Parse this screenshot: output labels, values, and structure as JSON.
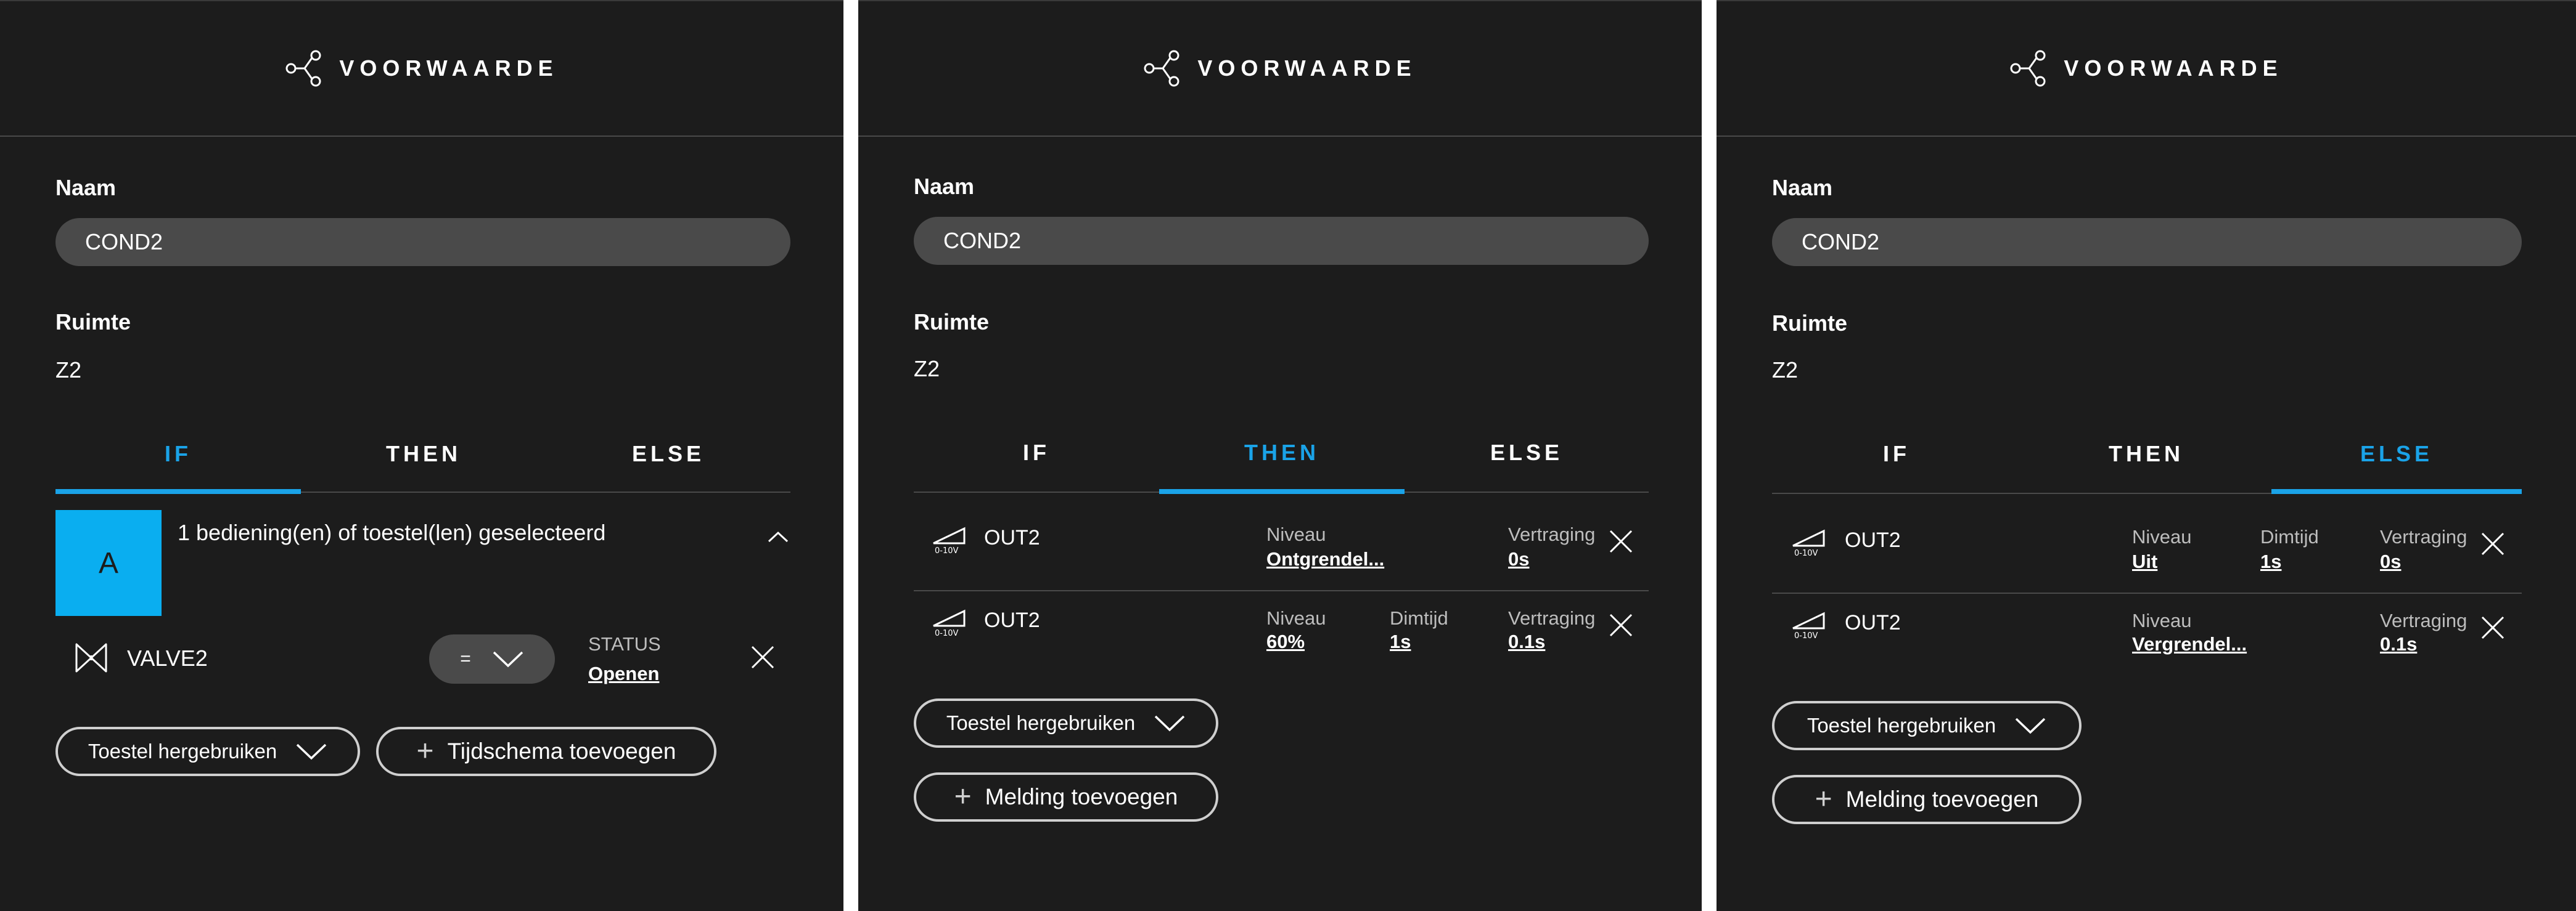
{
  "header_title": "VOORWAARDE",
  "name_label": "Naam",
  "name_value": "COND2",
  "room_label": "Ruimte",
  "room_value": "Z2",
  "tabs": [
    "IF",
    "THEN",
    "ELSE"
  ],
  "colors": {
    "accent": "#1aa3e8",
    "panel_bg": "#1c1c1c",
    "input_bg": "#4a4a4a",
    "avatar": "#0aaef0"
  },
  "panel_if": {
    "active_tab": "IF",
    "selection_text": "1 bediening(en) of toestel(len) geselecteerd",
    "avatar_letter": "A",
    "device": {
      "icon": "valve-icon",
      "name": "VALVE2",
      "operator": "=",
      "status_label": "STATUS",
      "status_value": "Openen"
    },
    "reuse_button": "Toestel hergebruiken",
    "add_schedule_button": "Tijdschema toevoegen"
  },
  "panel_then": {
    "active_tab": "THEN",
    "rows": [
      {
        "icon": "dimmer-0-10v-icon",
        "name": "OUT2",
        "level_label": "Niveau",
        "level_value": "Ontgrendel...",
        "delay_label": "Vertraging",
        "delay_value": "0s"
      },
      {
        "icon": "dimmer-0-10v-icon",
        "name": "OUT2",
        "level_label": "Niveau",
        "level_value": "60%",
        "dim_label": "Dimtijd",
        "dim_value": "1s",
        "delay_label": "Vertraging",
        "delay_value": "0.1s"
      }
    ],
    "reuse_button": "Toestel hergebruiken",
    "add_notification_button": "Melding toevoegen"
  },
  "panel_else": {
    "active_tab": "ELSE",
    "rows": [
      {
        "icon": "dimmer-0-10v-icon",
        "name": "OUT2",
        "level_label": "Niveau",
        "level_value": "Uit",
        "dim_label": "Dimtijd",
        "dim_value": "1s",
        "delay_label": "Vertraging",
        "delay_value": "0s"
      },
      {
        "icon": "dimmer-0-10v-icon",
        "name": "OUT2",
        "level_label": "Niveau",
        "level_value": "Vergrendel...",
        "delay_label": "Vertraging",
        "delay_value": "0.1s"
      }
    ],
    "reuse_button": "Toestel hergebruiken",
    "add_notification_button": "Melding toevoegen"
  },
  "dimmer_icon_caption": "0-10V"
}
